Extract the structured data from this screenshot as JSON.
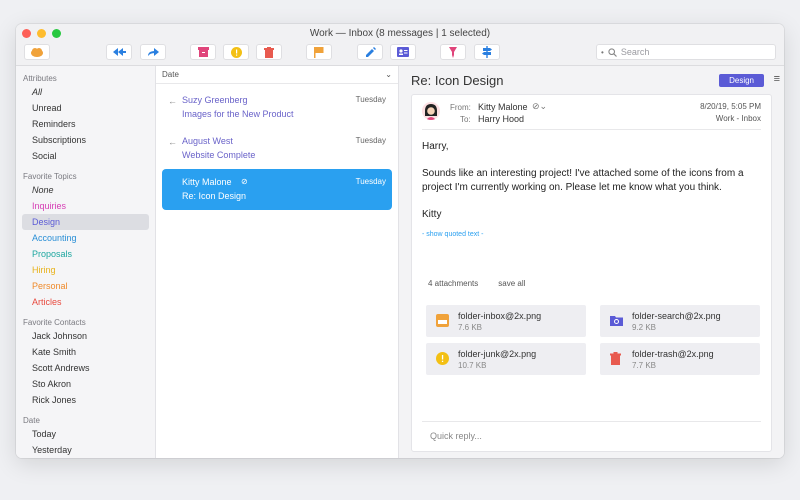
{
  "window": {
    "title": "Work — Inbox (8 messages | 1 selected)"
  },
  "toolbar": {
    "buttons": [
      {
        "name": "cloud-icon",
        "color": "#f0a23a"
      },
      {
        "name": "reply-all-icon",
        "color": "#2a7fe0"
      },
      {
        "name": "forward-icon",
        "color": "#2a7fe0"
      },
      {
        "name": "archive-icon",
        "color": "#e0457b"
      },
      {
        "name": "junk-icon",
        "color": "#f3c014"
      },
      {
        "name": "trash-icon",
        "color": "#e85a4f"
      },
      {
        "name": "flag-icon",
        "color": "#f0a23a"
      },
      {
        "name": "compose-icon",
        "color": "#2a7fe0"
      },
      {
        "name": "contact-card-icon",
        "color": "#5b5bd6"
      },
      {
        "name": "pin-icon",
        "color": "#e0457b"
      },
      {
        "name": "signpost-icon",
        "color": "#2a7fe0"
      }
    ],
    "search_placeholder": "Search"
  },
  "sidebar": {
    "attributes_title": "Attributes",
    "attributes": [
      "All",
      "Unread",
      "Reminders",
      "Subscriptions",
      "Social"
    ],
    "topics_title": "Favorite Topics",
    "topics": [
      {
        "label": "None",
        "color": "#333333"
      },
      {
        "label": "Inquiries",
        "color": "#d63cb4"
      },
      {
        "label": "Design",
        "color": "#5b5bd6"
      },
      {
        "label": "Accounting",
        "color": "#2a8fd6"
      },
      {
        "label": "Proposals",
        "color": "#1ea7a0"
      },
      {
        "label": "Hiring",
        "color": "#e8b21a"
      },
      {
        "label": "Personal",
        "color": "#ef8a2a"
      },
      {
        "label": "Articles",
        "color": "#e84a3f"
      }
    ],
    "contacts_title": "Favorite Contacts",
    "contacts": [
      "Jack Johnson",
      "Kate Smith",
      "Scott Andrews",
      "Sto Akron",
      "Rick Jones"
    ],
    "date_title": "Date",
    "dates": [
      "Today",
      "Yesterday"
    ]
  },
  "list": {
    "sort_label": "Date",
    "messages": [
      {
        "from": "Suzy Greenberg",
        "subject": "Images for the New Product",
        "date": "Tuesday",
        "replied": true,
        "attachment": false
      },
      {
        "from": "August West",
        "subject": "Website Complete",
        "date": "Tuesday",
        "replied": true,
        "attachment": false
      },
      {
        "from": "Kitty Malone",
        "subject": "Re: Icon Design",
        "date": "Tuesday",
        "replied": false,
        "attachment": true
      }
    ]
  },
  "reader": {
    "subject": "Re: Icon Design",
    "tag": "Design",
    "from_label": "From:",
    "from": "Kitty Malone",
    "to_label": "To:",
    "to": "Harry Hood",
    "datetime": "8/20/19, 5:05 PM",
    "mailbox": "Work - Inbox",
    "body": {
      "greeting": "Harry,",
      "paragraph": "Sounds like an interesting project! I've attached some of the icons from a project I'm currently working on. Please let me know what you think.",
      "signature": "Kitty"
    },
    "show_quoted": "- show quoted text -",
    "attachments_count": "4 attachments",
    "save_all": "save all",
    "attachments": [
      {
        "name": "folder-inbox@2x.png",
        "size": "7.6 KB",
        "icon": "inbox-icon",
        "color": "#f0a23a"
      },
      {
        "name": "folder-search@2x.png",
        "size": "9.2 KB",
        "icon": "folder-search-icon",
        "color": "#5b5bd6"
      },
      {
        "name": "folder-junk@2x.png",
        "size": "10.7 KB",
        "icon": "junk-icon",
        "color": "#f3c014"
      },
      {
        "name": "folder-trash@2x.png",
        "size": "7.7 KB",
        "icon": "trash-icon",
        "color": "#e85a4f"
      }
    ],
    "quick_reply": "Quick reply..."
  }
}
